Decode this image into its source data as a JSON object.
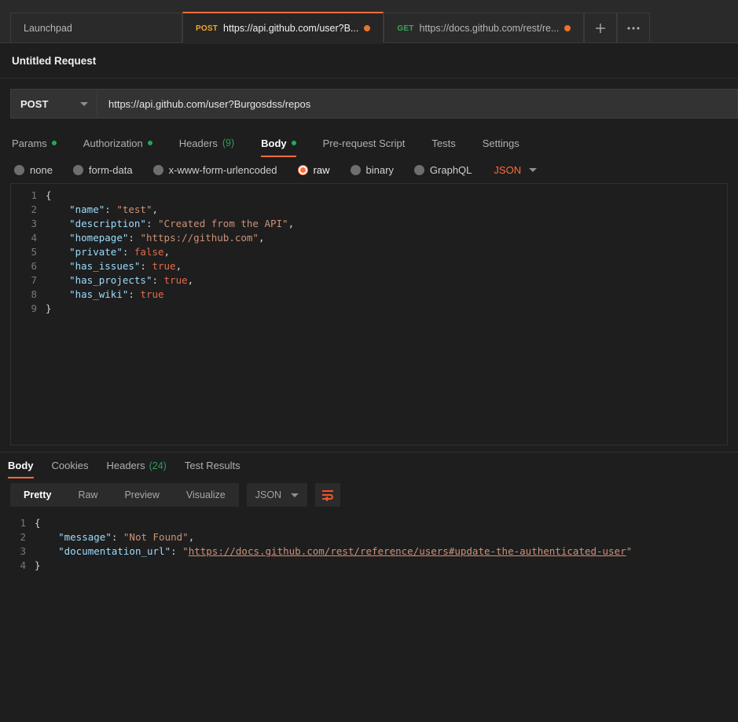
{
  "tabbar": {
    "tabs": [
      {
        "label": "Launchpad",
        "method": "",
        "unsaved": false,
        "active": false
      },
      {
        "label": "https://api.github.com/user?B...",
        "method": "POST",
        "unsaved": true,
        "active": true
      },
      {
        "label": "https://docs.github.com/rest/re...",
        "method": "GET",
        "unsaved": true,
        "active": false
      }
    ],
    "new_tab_icon": "plus-icon",
    "more_icon": "ellipsis-icon"
  },
  "request": {
    "title": "Untitled Request",
    "method": "POST",
    "url": "https://api.github.com/user?Burgosdss/repos",
    "tabs": [
      {
        "label": "Params",
        "indicator": "dot"
      },
      {
        "label": "Authorization",
        "indicator": "dot"
      },
      {
        "label": "Headers",
        "count": "(9)"
      },
      {
        "label": "Body",
        "indicator": "dot",
        "active": true
      },
      {
        "label": "Pre-request Script"
      },
      {
        "label": "Tests"
      },
      {
        "label": "Settings"
      }
    ],
    "body_types": [
      {
        "label": "none",
        "selected": false
      },
      {
        "label": "form-data",
        "selected": false
      },
      {
        "label": "x-www-form-urlencoded",
        "selected": false
      },
      {
        "label": "raw",
        "selected": true
      },
      {
        "label": "binary",
        "selected": false
      },
      {
        "label": "GraphQL",
        "selected": false
      }
    ],
    "body_format": "JSON",
    "body_lines": [
      {
        "n": "1",
        "tokens": [
          {
            "t": "{",
            "c": "k-brace"
          }
        ]
      },
      {
        "n": "2",
        "tokens": [
          {
            "t": "    ",
            "c": "k-punct"
          },
          {
            "t": "\"name\"",
            "c": "k-key"
          },
          {
            "t": ": ",
            "c": "k-punct"
          },
          {
            "t": "\"test\"",
            "c": "k-str"
          },
          {
            "t": ",",
            "c": "k-punct"
          }
        ]
      },
      {
        "n": "3",
        "tokens": [
          {
            "t": "    ",
            "c": "k-punct"
          },
          {
            "t": "\"description\"",
            "c": "k-key"
          },
          {
            "t": ": ",
            "c": "k-punct"
          },
          {
            "t": "\"Created from the API\"",
            "c": "k-str"
          },
          {
            "t": ",",
            "c": "k-punct"
          }
        ]
      },
      {
        "n": "4",
        "tokens": [
          {
            "t": "    ",
            "c": "k-punct"
          },
          {
            "t": "\"homepage\"",
            "c": "k-key"
          },
          {
            "t": ": ",
            "c": "k-punct"
          },
          {
            "t": "\"https://github.com\"",
            "c": "k-str"
          },
          {
            "t": ",",
            "c": "k-punct"
          }
        ]
      },
      {
        "n": "5",
        "tokens": [
          {
            "t": "    ",
            "c": "k-punct"
          },
          {
            "t": "\"private\"",
            "c": "k-key"
          },
          {
            "t": ": ",
            "c": "k-punct"
          },
          {
            "t": "false",
            "c": "k-bool"
          },
          {
            "t": ",",
            "c": "k-punct"
          }
        ]
      },
      {
        "n": "6",
        "tokens": [
          {
            "t": "    ",
            "c": "k-punct"
          },
          {
            "t": "\"has_issues\"",
            "c": "k-key"
          },
          {
            "t": ": ",
            "c": "k-punct"
          },
          {
            "t": "true",
            "c": "k-bool"
          },
          {
            "t": ",",
            "c": "k-punct"
          }
        ]
      },
      {
        "n": "7",
        "tokens": [
          {
            "t": "    ",
            "c": "k-punct"
          },
          {
            "t": "\"has_projects\"",
            "c": "k-key"
          },
          {
            "t": ": ",
            "c": "k-punct"
          },
          {
            "t": "true",
            "c": "k-bool"
          },
          {
            "t": ",",
            "c": "k-punct"
          }
        ]
      },
      {
        "n": "8",
        "tokens": [
          {
            "t": "    ",
            "c": "k-punct"
          },
          {
            "t": "\"has_wiki\"",
            "c": "k-key"
          },
          {
            "t": ": ",
            "c": "k-punct"
          },
          {
            "t": "true",
            "c": "k-bool"
          }
        ]
      },
      {
        "n": "9",
        "tokens": [
          {
            "t": "}",
            "c": "k-brace"
          }
        ]
      }
    ]
  },
  "response": {
    "tabs": [
      {
        "label": "Body",
        "active": true
      },
      {
        "label": "Cookies"
      },
      {
        "label": "Headers",
        "count": "(24)"
      },
      {
        "label": "Test Results"
      }
    ],
    "view_modes": [
      {
        "label": "Pretty",
        "active": true
      },
      {
        "label": "Raw"
      },
      {
        "label": "Preview"
      },
      {
        "label": "Visualize"
      }
    ],
    "format": "JSON",
    "wrap_icon": "wrap-lines-icon",
    "body_lines": [
      {
        "n": "1",
        "tokens": [
          {
            "t": "{",
            "c": "k-brace"
          }
        ]
      },
      {
        "n": "2",
        "tokens": [
          {
            "t": "    ",
            "c": "k-punct"
          },
          {
            "t": "\"message\"",
            "c": "k-key"
          },
          {
            "t": ": ",
            "c": "k-punct"
          },
          {
            "t": "\"Not Found\"",
            "c": "k-str"
          },
          {
            "t": ",",
            "c": "k-punct"
          }
        ]
      },
      {
        "n": "3",
        "tokens": [
          {
            "t": "    ",
            "c": "k-punct"
          },
          {
            "t": "\"documentation_url\"",
            "c": "k-key"
          },
          {
            "t": ": ",
            "c": "k-punct"
          },
          {
            "t": "\"",
            "c": "k-str"
          },
          {
            "t": "https://docs.github.com/rest/reference/users#update-the-authenticated-user",
            "c": "k-link"
          },
          {
            "t": "\"",
            "c": "k-str"
          }
        ]
      },
      {
        "n": "4",
        "tokens": [
          {
            "t": "}",
            "c": "k-brace"
          }
        ]
      }
    ]
  },
  "colors": {
    "accent": "#ff6c37",
    "green": "#1bab5a",
    "method_post": "#f5a623",
    "method_get": "#3aa757",
    "json_key": "#9cdcfe",
    "json_string": "#ce9178",
    "json_bool": "#e06c4c",
    "background": "#1e1e1e"
  }
}
